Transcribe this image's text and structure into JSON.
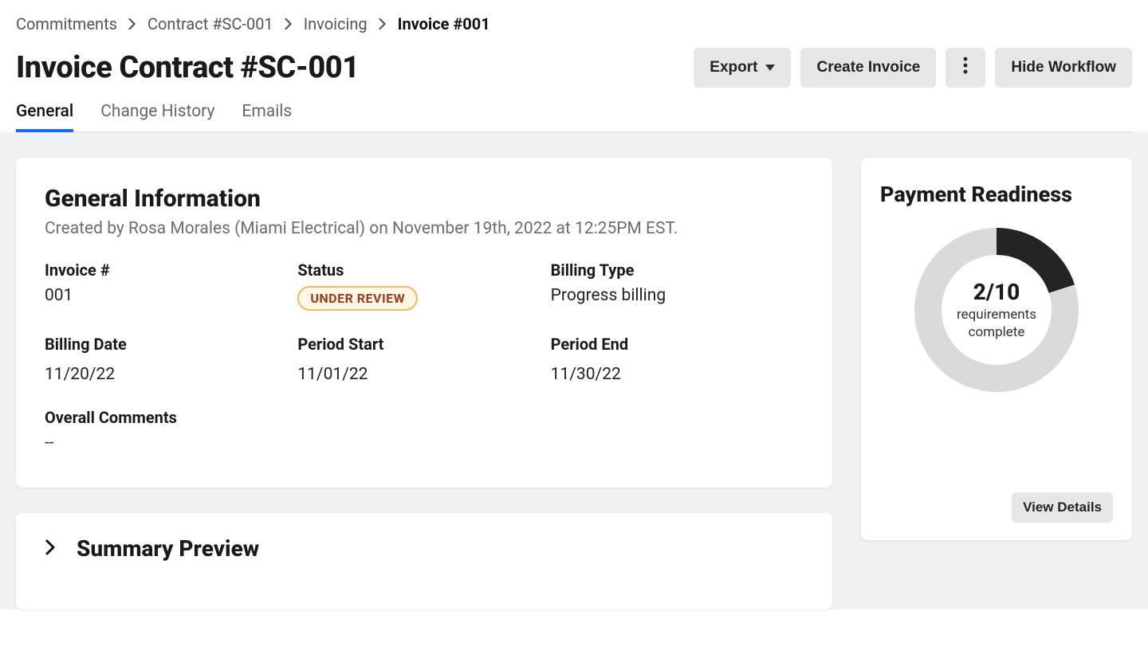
{
  "breadcrumb": {
    "items": [
      {
        "label": "Commitments"
      },
      {
        "label": "Contract #SC-001"
      },
      {
        "label": "Invoicing"
      },
      {
        "label": "Invoice #001"
      }
    ]
  },
  "header": {
    "title": "Invoice Contract #SC-001",
    "export_label": "Export",
    "create_invoice_label": "Create Invoice",
    "hide_workflow_label": "Hide Workflow"
  },
  "tabs": [
    {
      "label": "General",
      "active": true
    },
    {
      "label": "Change History"
    },
    {
      "label": "Emails"
    }
  ],
  "general": {
    "heading": "General Information",
    "created_line": "Created by Rosa Morales (Miami Electrical) on November 19th, 2022 at 12:25PM EST.",
    "fields": {
      "invoice_number": {
        "label": "Invoice #",
        "value": "001"
      },
      "status": {
        "label": "Status",
        "value": "UNDER REVIEW"
      },
      "billing_type": {
        "label": "Billing Type",
        "value": "Progress billing"
      },
      "billing_date": {
        "label": "Billing Date",
        "value": "11/20/22"
      },
      "period_start": {
        "label": "Period Start",
        "value": "11/01/22"
      },
      "period_end": {
        "label": "Period End",
        "value": "11/30/22"
      },
      "overall_comments": {
        "label": "Overall Comments",
        "value": "--"
      }
    }
  },
  "readiness": {
    "heading": "Payment Readiness",
    "count_text": "2/10",
    "sub_text": "requirements complete",
    "completed": 2,
    "total": 10,
    "colors": {
      "track": "#d8dadc",
      "progress": "#222426"
    },
    "view_details_label": "View Details"
  },
  "summary": {
    "heading": "Summary Preview"
  }
}
